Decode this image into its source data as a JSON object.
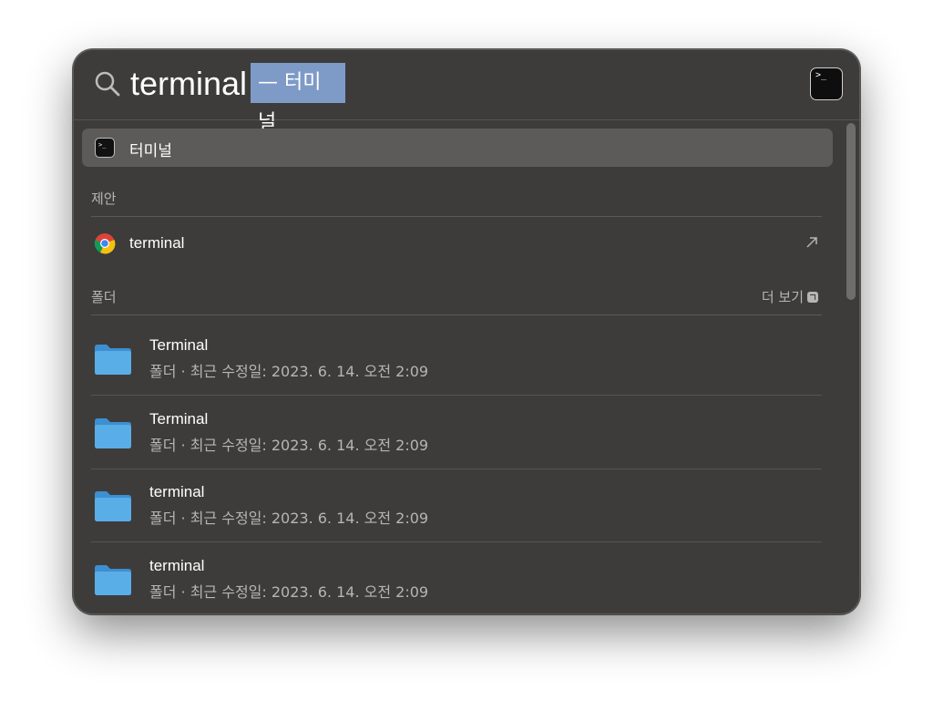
{
  "search": {
    "query": "terminal",
    "completion": "— 터미널"
  },
  "top_hit": {
    "label": "터미널",
    "icon": "terminal-icon"
  },
  "sections": {
    "suggestions_title": "제안",
    "folders_title": "폴더",
    "see_more": "더 보기"
  },
  "suggestion": {
    "label": "terminal",
    "icon": "chrome-icon"
  },
  "folders": [
    {
      "name": "Terminal",
      "meta": "폴더 · 최근 수정일: 2023. 6. 14. 오전 2:09"
    },
    {
      "name": "Terminal",
      "meta": "폴더 · 최근 수정일: 2023. 6. 14. 오전 2:09"
    },
    {
      "name": "terminal",
      "meta": "폴더 · 최근 수정일: 2023. 6. 14. 오전 2:09"
    },
    {
      "name": "terminal",
      "meta": "폴더 · 최근 수정일: 2023. 6. 14. 오전 2:09"
    }
  ],
  "colors": {
    "panel": "#3d3c3b",
    "selection": "#5c5b5a",
    "completion_highlight": "#7e9ac7",
    "folder_blue": "#5aaee8"
  }
}
